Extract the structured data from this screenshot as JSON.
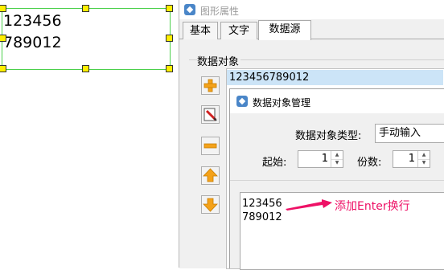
{
  "canvas": {
    "lines": [
      "123456",
      "789012"
    ]
  },
  "dialog1": {
    "title": "图形属性",
    "tabs": [
      {
        "label": "基本",
        "active": false
      },
      {
        "label": "文字",
        "active": false
      },
      {
        "label": "数据源",
        "active": true
      }
    ],
    "group_label": "数据对象",
    "list_items": [
      "123456789012"
    ],
    "side_buttons": [
      "add-icon",
      "edit-icon",
      "remove-icon",
      "move-up-icon",
      "move-down-icon"
    ]
  },
  "dialog2": {
    "title": "数据对象管理",
    "type_label": "数据对象类型:",
    "type_value": "手动输入",
    "start_label": "起始:",
    "start_value": "1",
    "digits_label": "份数:",
    "digits_value": "1",
    "text_lines": [
      "123456",
      "789012"
    ]
  },
  "annotation": {
    "text": "添加Enter换行",
    "color": "#ee1166"
  },
  "colors": {
    "selection_border": "#4cd04c",
    "handle_fill": "#ffee00",
    "list_selected": "#cce4f7"
  }
}
